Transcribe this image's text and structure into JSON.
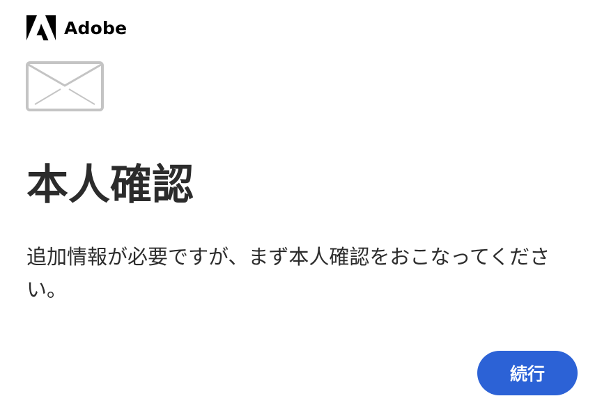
{
  "brand": {
    "logo_icon": "adobe-logo-icon",
    "name": "Adobe"
  },
  "hero_icon": "mail-envelope-icon",
  "heading": "本人確認",
  "message": "追加情報が必要ですが、まず本人確認をおこなってください。",
  "actions": {
    "continue_label": "続行"
  },
  "colors": {
    "primary_button": "#2c62d6",
    "text": "#2c2c2c",
    "icon_stroke": "#c4c4c4"
  }
}
